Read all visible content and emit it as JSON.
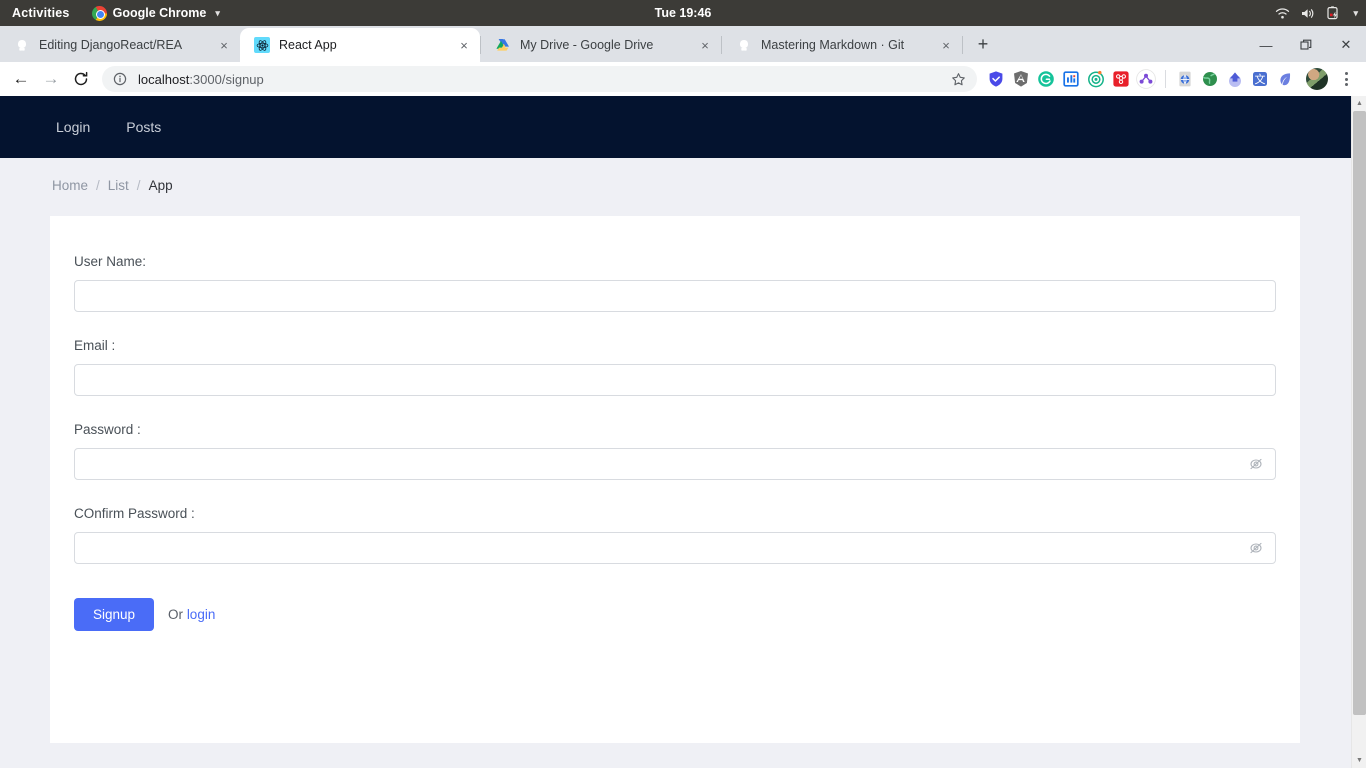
{
  "system_bar": {
    "activities": "Activities",
    "app_name": "Google Chrome",
    "clock": "Tue 19:46",
    "icons": [
      "wifi-icon",
      "volume-icon",
      "battery-icon",
      "chevron-down-icon"
    ]
  },
  "browser": {
    "tabs": [
      {
        "title": "Editing DjangoReact/REA",
        "favicon": "github-icon",
        "active": false
      },
      {
        "title": "React App",
        "favicon": "react-icon",
        "active": true
      },
      {
        "title": "My Drive - Google Drive",
        "favicon": "google-drive-icon",
        "active": false
      },
      {
        "title": "Mastering Markdown · Git",
        "favicon": "github-icon",
        "active": false
      }
    ],
    "new_tab_label": "+",
    "close_label": "×",
    "window_controls": {
      "minimize": "—",
      "maximize": "❐",
      "close": "✕"
    },
    "toolbar": {
      "back": "←",
      "forward": "→",
      "reload": "↻",
      "site_info_icon": "info-circle-icon",
      "url_host": "localhost",
      "url_path": ":3000/signup",
      "url_full": "localhost:3000/signup",
      "bookmark_icon": "star-icon",
      "menu_icon": "kebab-menu-icon",
      "extensions": [
        "shield-check-icon",
        "angular-icon",
        "grammarly-icon",
        "lighthouse-icon",
        "target-icon",
        "redux-devtools-icon",
        "react-devtools-icon",
        "wappalyzer-icon",
        "globe-icon",
        "upload-icon",
        "translate-icon",
        "leaf-icon"
      ],
      "profile_avatar": "user-avatar"
    }
  },
  "page": {
    "navbar": {
      "links": [
        {
          "label": "Login"
        },
        {
          "label": "Posts"
        }
      ]
    },
    "breadcrumb": {
      "separator": "/",
      "items": [
        {
          "label": "Home",
          "current": false
        },
        {
          "label": "List",
          "current": false
        },
        {
          "label": "App",
          "current": true
        }
      ]
    },
    "form": {
      "fields": [
        {
          "label": "User Name:",
          "value": "",
          "placeholder": "",
          "type": "text",
          "eye_icon": null
        },
        {
          "label": "Email :",
          "value": "",
          "placeholder": "",
          "type": "text",
          "eye_icon": null
        },
        {
          "label": "Password :",
          "value": "",
          "placeholder": "",
          "type": "password",
          "eye_icon": "eye-slash-icon"
        },
        {
          "label": "COnfirm Password :",
          "value": "",
          "placeholder": "",
          "type": "password",
          "eye_icon": "eye-slash-icon"
        }
      ],
      "submit_label": "Signup",
      "or_text": "Or",
      "login_link_label": "login"
    }
  },
  "colors": {
    "navbar_bg": "#04132f",
    "page_bg": "#eff0f5",
    "card_bg": "#ffffff",
    "accent": "#4a6cf7",
    "label_text": "#495057",
    "muted_text": "#8f96a3",
    "tabstrip_bg": "#dee1e6",
    "gnome_bar_bg": "#3c3b37"
  },
  "scroll": {
    "up_arrow": "▲",
    "down_arrow": "▼"
  }
}
